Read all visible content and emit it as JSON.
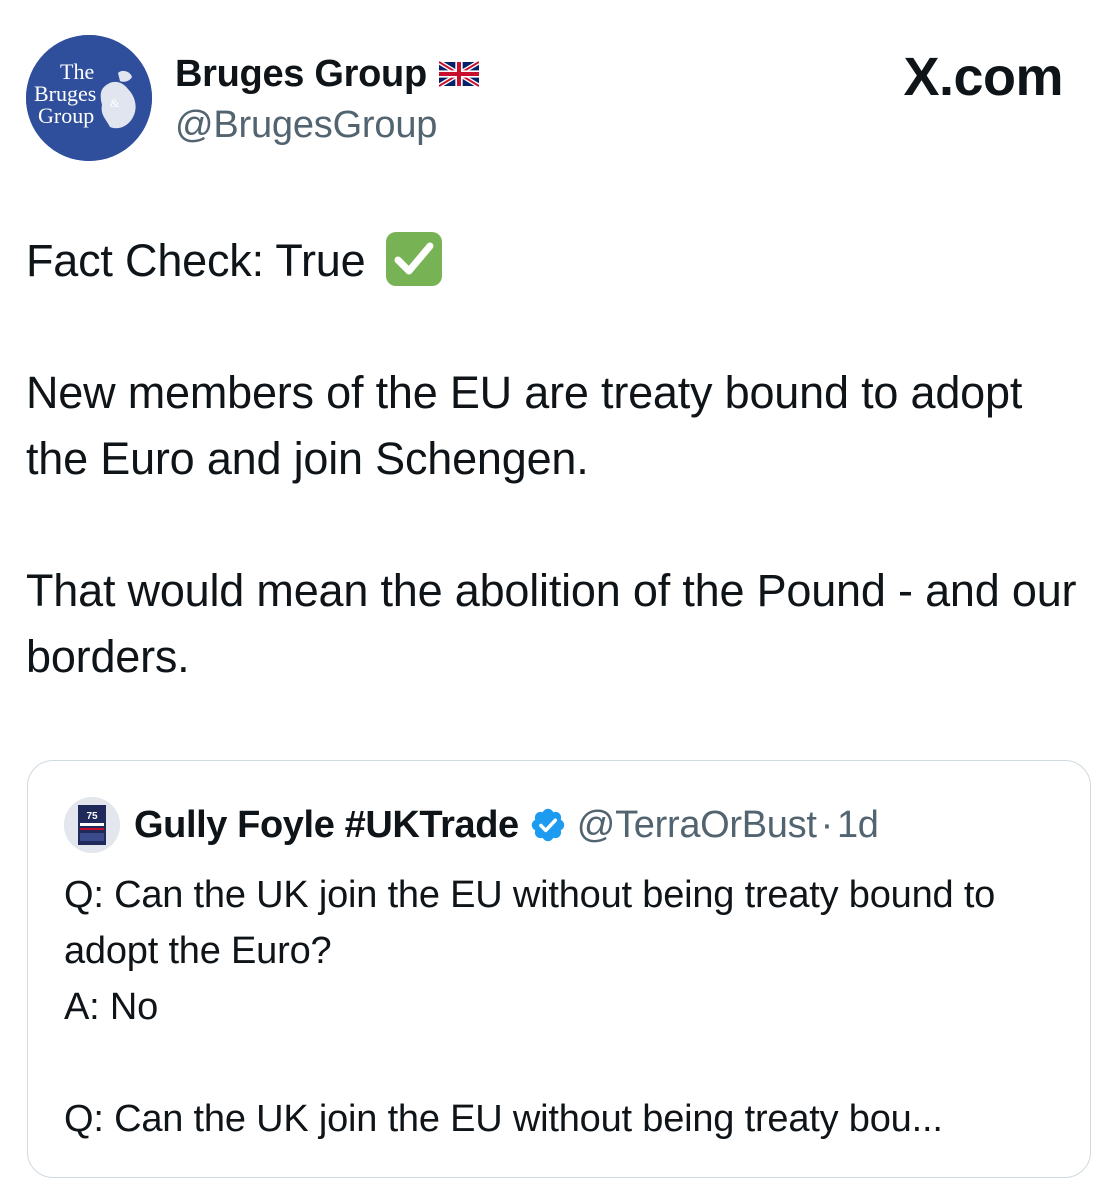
{
  "tweet": {
    "author": {
      "display_name": "Bruges Group",
      "handle": "@BrugesGroup",
      "flag_icon": "uk-flag-icon",
      "avatar_icon": "bruges-group-logo",
      "avatar_color": "#2f4f9c"
    },
    "brand": "X.com",
    "body": {
      "line1": "Fact Check: True",
      "line1_icon": "white-check-mark-icon",
      "para2": "New members of the EU are treaty bound to adopt the Euro and join Schengen.",
      "para3": "That would mean the abolition of the Pound - and our borders."
    }
  },
  "quote": {
    "display_name": "Gully Foyle #UKTrade",
    "verified_icon": "verified-badge-icon",
    "verified_color": "#1d9bf0",
    "handle": "@TerraOrBust",
    "separator": "·",
    "time": "1d",
    "body": {
      "q1": "Q: Can the UK join the EU without being treaty bound to adopt the Euro?",
      "a1": "A: No",
      "q2": "Q: Can the UK join the EU without being treaty bou..."
    }
  }
}
